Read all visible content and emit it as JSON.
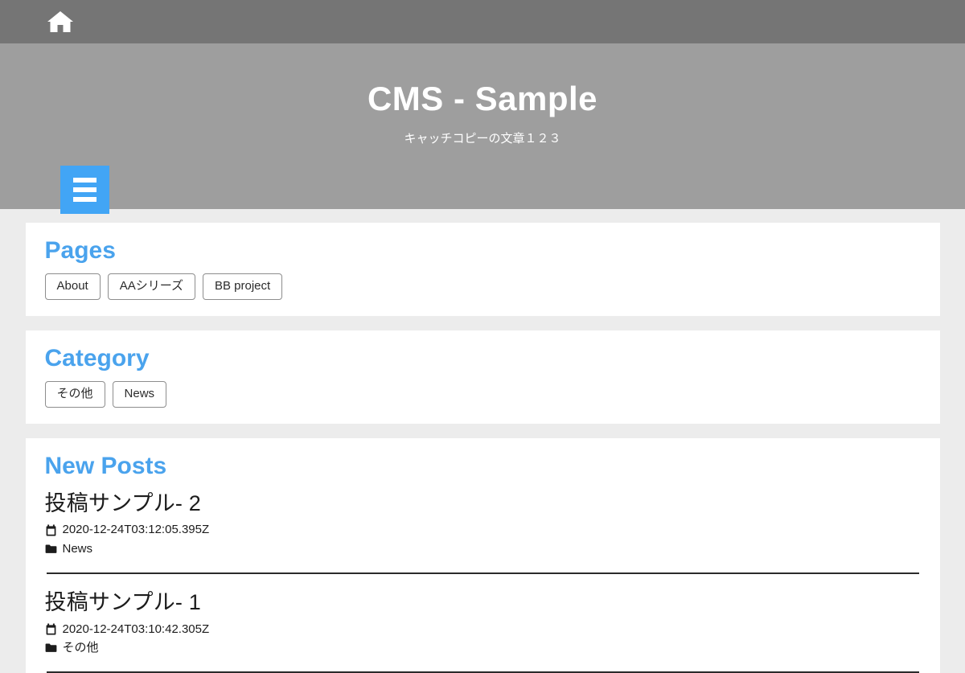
{
  "navbar": {
    "home_icon": "home-icon"
  },
  "hero": {
    "title": "CMS - Sample",
    "tagline": "キャッチコピーの文章１２３",
    "menu_icon": "hamburger-icon",
    "accent_color": "#42a5f5",
    "background_color": "#9e9e9e",
    "navbar_color": "#757575"
  },
  "sections": {
    "pages": {
      "title": "Pages",
      "items": [
        {
          "label": "About"
        },
        {
          "label": "AAシリーズ"
        },
        {
          "label": "BB project"
        }
      ]
    },
    "category": {
      "title": "Category",
      "items": [
        {
          "label": "その他"
        },
        {
          "label": "News"
        }
      ]
    },
    "new_posts": {
      "title": "New Posts",
      "posts": [
        {
          "title": "投稿サンプル- 2",
          "date": "2020-12-24T03:12:05.395Z",
          "category": "News",
          "date_icon": "calendar-icon",
          "category_icon": "folder-icon"
        },
        {
          "title": "投稿サンプル- 1",
          "date": "2020-12-24T03:10:42.305Z",
          "category": "その他",
          "date_icon": "calendar-icon",
          "category_icon": "folder-icon"
        }
      ]
    }
  },
  "theme": {
    "heading_color": "#4aa3ed",
    "page_background": "#ececec",
    "card_background": "#ffffff"
  }
}
